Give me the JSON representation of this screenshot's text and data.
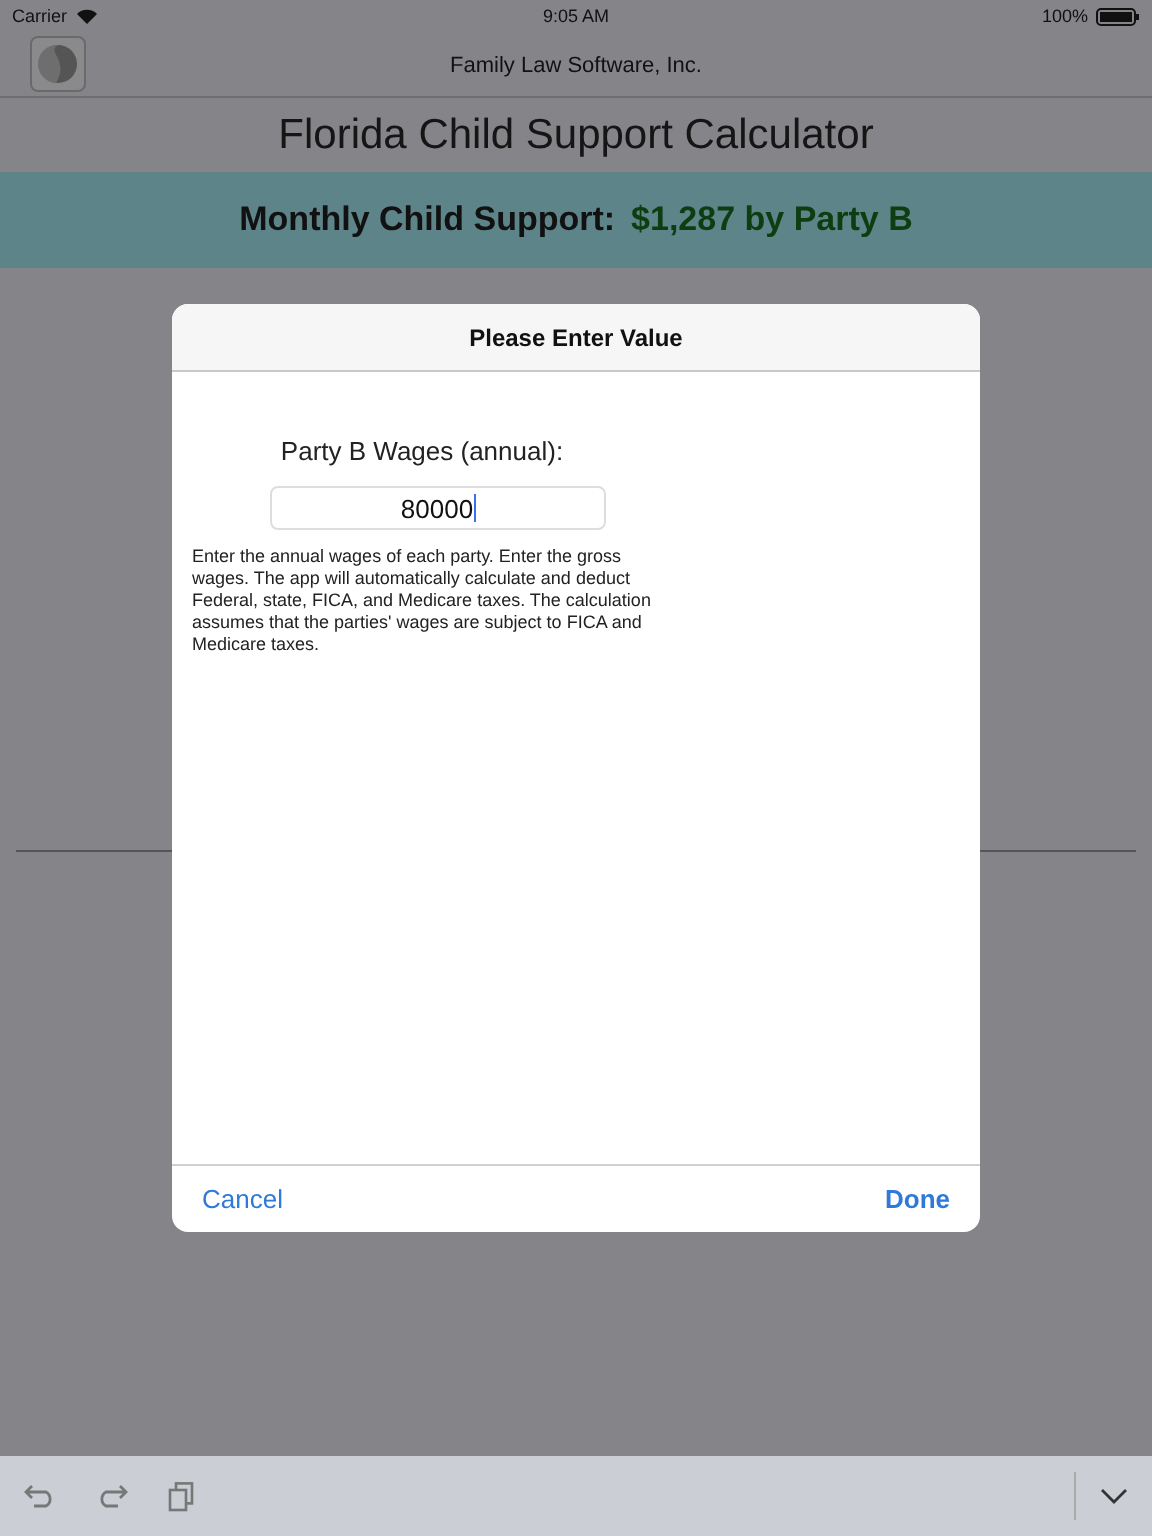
{
  "status_bar": {
    "carrier": "Carrier",
    "time": "9:05 AM",
    "battery": "100%"
  },
  "nav_bar": {
    "title": "Family Law Software, Inc."
  },
  "page_title": "Florida Child Support Calculator",
  "summary": {
    "label": "Monthly Child Support:",
    "value": "$1,287 by Party B"
  },
  "dialog": {
    "title": "Please Enter Value",
    "field_label": "Party B Wages (annual):",
    "field_value": "80000",
    "help": "Enter the annual wages of each party. Enter the gross wages. The app will automatically calculate and deduct Federal, state, FICA, and Medicare taxes.  The calculation assumes that the parties' wages are subject to FICA and Medicare taxes.",
    "buttons": [
      {
        "label": "Cancel",
        "kind": "cancel"
      },
      {
        "label": "Done",
        "kind": "confirm"
      }
    ]
  }
}
